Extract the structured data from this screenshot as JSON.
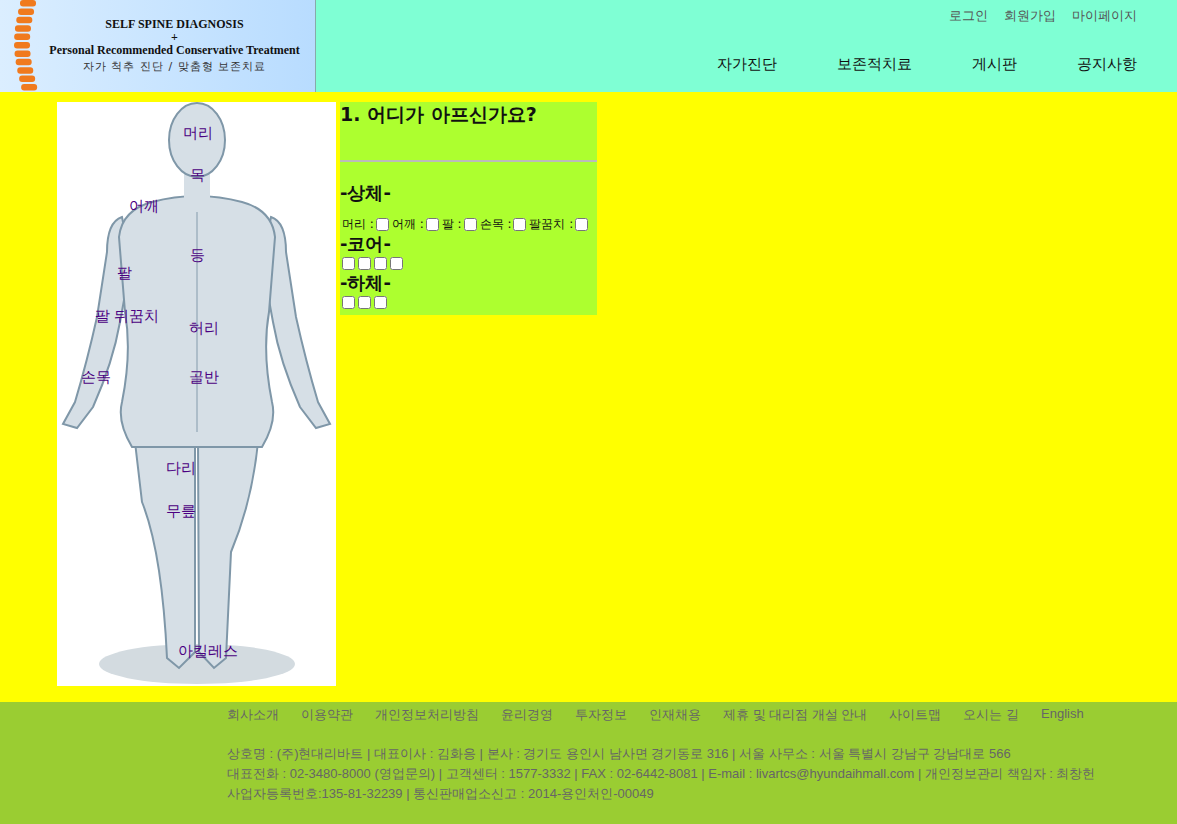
{
  "header": {
    "logo_lines": [
      "SELF SPINE DIAGNOSIS",
      "+",
      "Personal Recommended Conservative Treatment",
      "자가 척추 진단 / 맞춤형 보존치료"
    ],
    "top_links": [
      "로그인",
      "회원가입",
      "마이페이지"
    ],
    "nav": [
      "자가진단",
      "보존적치료",
      "게시판",
      "공지사항"
    ]
  },
  "body_map": {
    "labels": [
      "머리",
      "목",
      "어깨",
      "등",
      "팔",
      "팔 뒤꿈치",
      "허리",
      "손목",
      "골반",
      "다리",
      "무릎",
      "아킬레스"
    ]
  },
  "survey": {
    "title": "1. 어디가 아프신가요?",
    "sections": [
      {
        "heading": "-상체-",
        "items": [
          {
            "label": "머리 :",
            "checked": false
          },
          {
            "label": "어깨 :",
            "checked": false
          },
          {
            "label": "팔 :",
            "checked": false
          },
          {
            "label": "손목 :",
            "checked": false
          },
          {
            "label": "팔꿈치 :",
            "checked": false
          }
        ]
      },
      {
        "heading": "-코어-",
        "items": [
          {
            "label": "",
            "checked": false
          },
          {
            "label": "",
            "checked": false
          },
          {
            "label": "",
            "checked": false
          },
          {
            "label": "",
            "checked": false
          }
        ]
      },
      {
        "heading": "-하체-",
        "items": [
          {
            "label": "",
            "checked": false
          },
          {
            "label": "",
            "checked": false
          },
          {
            "label": "",
            "checked": false
          }
        ]
      }
    ]
  },
  "footer": {
    "links": [
      "회사소개",
      "이용약관",
      "개인정보처리방침",
      "윤리경영",
      "투자정보",
      "인재채용",
      "제휴 및 대리점 개설 안내",
      "사이트맵",
      "오시는 길",
      "English"
    ],
    "info_lines": [
      "상호명 : (주)현대리바트 | 대표이사 : 김화응 | 본사 : 경기도 용인시 남사면 경기동로 316 | 서울 사무소 : 서울 특별시 강남구 강남대로 566",
      "대표전화 : 02-3480-8000 (영업문의) | 고객센터 : 1577-3332 | FAX : 02-6442-8081 | E-mail : livartcs@hyundaihmall.com | 개인정보관리 책임자 : 최창헌",
      "사업자등록번호:135-81-32239 | 통신판매업소신고 : 2014-용인처인-00049"
    ]
  }
}
